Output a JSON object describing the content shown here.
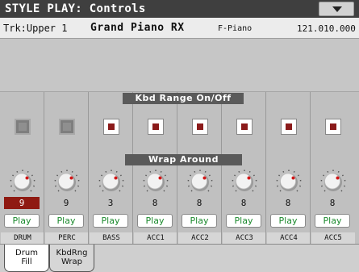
{
  "window": {
    "title": "STYLE PLAY: Controls"
  },
  "track": {
    "name": "Trk:Upper 1",
    "sound": "Grand Piano RX",
    "bank": "F-Piano",
    "tempo": "121.010.000"
  },
  "sections": {
    "kbd_range": "Kbd Range On/Off",
    "wrap_around": "Wrap Around"
  },
  "colors": {
    "accent": "#8b1a1a",
    "play_text": "#1c8a2e",
    "title_bg": "#3f3f3f",
    "section_bg": "#5a5a5a"
  },
  "tracks": [
    {
      "name": "DRUM",
      "wrap": "9",
      "kbd_on": null,
      "play": "Play",
      "highlight": true
    },
    {
      "name": "PERC",
      "wrap": "9",
      "kbd_on": null,
      "play": "Play"
    },
    {
      "name": "BASS",
      "wrap": "3",
      "kbd_on": true,
      "play": "Play"
    },
    {
      "name": "ACC1",
      "wrap": "8",
      "kbd_on": true,
      "play": "Play"
    },
    {
      "name": "ACC2",
      "wrap": "8",
      "kbd_on": true,
      "play": "Play"
    },
    {
      "name": "ACC3",
      "wrap": "8",
      "kbd_on": true,
      "play": "Play"
    },
    {
      "name": "ACC4",
      "wrap": "8",
      "kbd_on": true,
      "play": "Play"
    },
    {
      "name": "ACC5",
      "wrap": "8",
      "kbd_on": true,
      "play": "Play"
    }
  ],
  "tabs": [
    {
      "label_line1": "Drum",
      "label_line2": "Fill",
      "active": true
    },
    {
      "label_line1": "KbdRng",
      "label_line2": "Wrap",
      "active": false
    }
  ]
}
